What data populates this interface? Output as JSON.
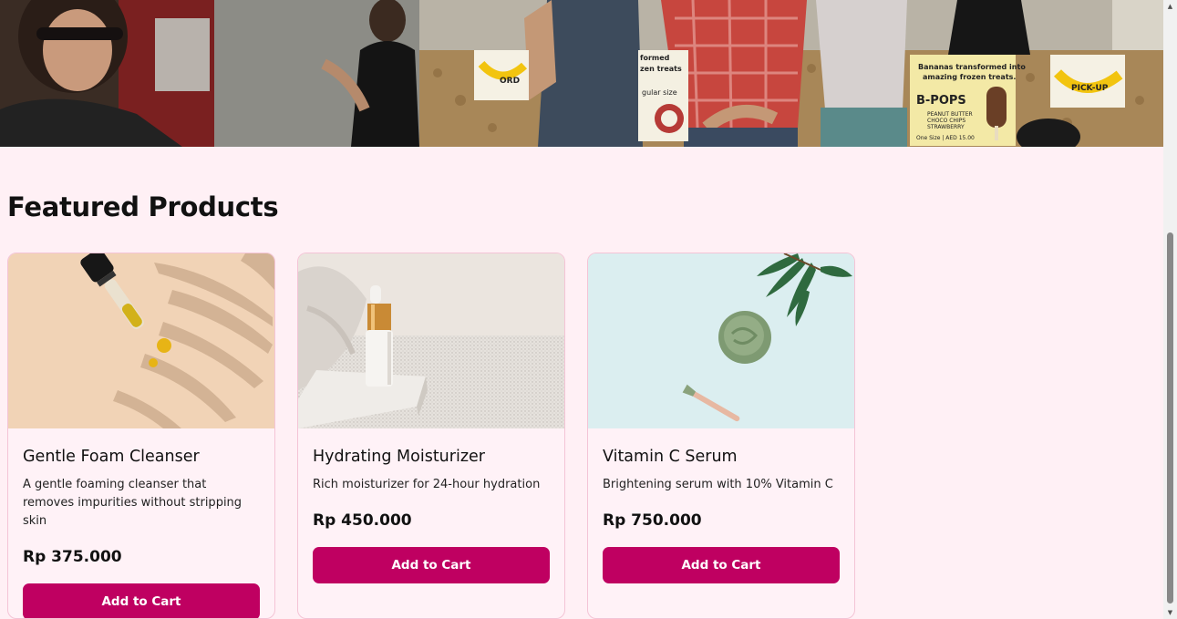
{
  "hero": {
    "sign_left": "ORD",
    "sign_center_1": "formed",
    "sign_center_2": "zen treats",
    "sign_center_3": "gular size",
    "sign_right_title_1": "Bananas transformed into",
    "sign_right_title_2": "amazing frozen treats.",
    "sign_right_brand": "B-POPS",
    "sign_right_items": [
      "PEANUT BUTTER",
      "CHOCO CHIPS",
      "STRAWBERRY"
    ],
    "sign_right_size": "One Size | AED 15.00",
    "sign_pickup": "PICK-UP"
  },
  "section": {
    "title": "Featured Products"
  },
  "products": [
    {
      "name": "Gentle Foam Cleanser",
      "description": "A gentle foaming cleanser that removes impurities without stripping skin",
      "price": "Rp 375.000",
      "button": "Add to Cart"
    },
    {
      "name": "Hydrating Moisturizer",
      "description": "Rich moisturizer for 24-hour hydration",
      "price": "Rp 450.000",
      "button": "Add to Cart"
    },
    {
      "name": "Vitamin C Serum",
      "description": "Brightening serum with 10% Vitamin C",
      "price": "Rp 750.000",
      "button": "Add to Cart"
    }
  ],
  "colors": {
    "page_background": "#fff0f5",
    "accent": "#bf0061",
    "card_border": "#f4c4d6"
  },
  "icons": {
    "scroll_up": "scroll-up-arrow-icon",
    "scroll_down": "scroll-down-arrow-icon"
  }
}
